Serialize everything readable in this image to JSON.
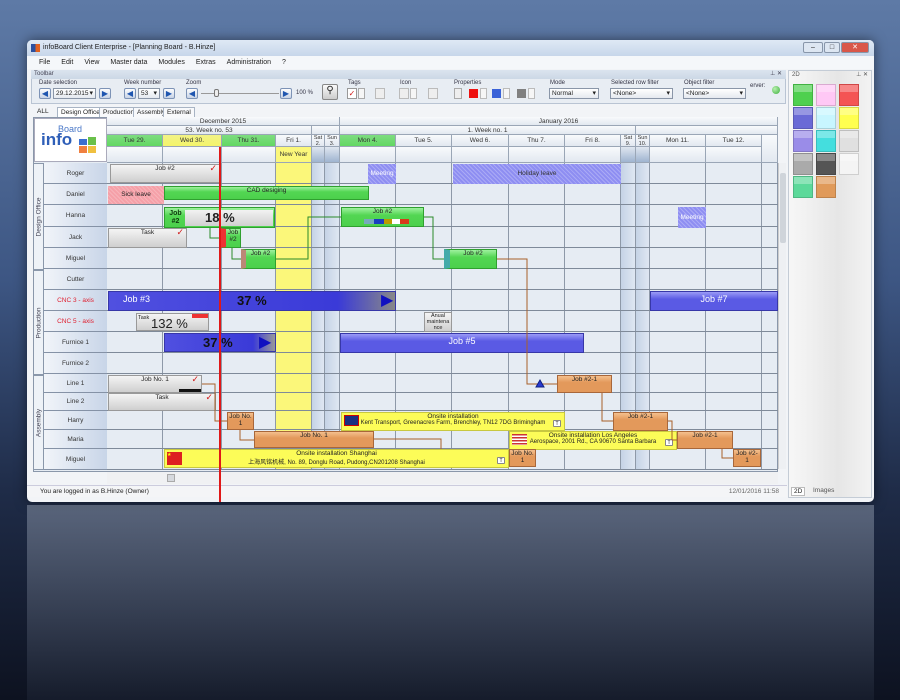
{
  "window": {
    "title": "infoBoard Client Enterprise - [Planning Board - B.Hinze]"
  },
  "menu": [
    "File",
    "Edit",
    "View",
    "Master data",
    "Modules",
    "Extras",
    "Administration",
    "?"
  ],
  "toolbar": {
    "title": "Toolbar",
    "date_label": "Date selection",
    "date_value": "29.12.2015",
    "week_label": "Week number",
    "week_value": "53",
    "zoom_label": "Zoom",
    "zoom_value": "100 %",
    "zoom_percent": 100,
    "tags_label": "Tags",
    "icon_label": "Icon",
    "properties_label": "Properties",
    "mode_label": "Mode",
    "mode_value": "Normal",
    "row_filter_label": "Selected row filter",
    "row_filter_value": "<None>",
    "object_filter_label": "Object filter",
    "object_filter_value": "<None>",
    "server_label": "erver:",
    "colors": {
      "prop1": "#ee1111",
      "prop2": "#3a62d8",
      "prop3": "#808080",
      "server": "#3cb03c"
    }
  },
  "tabs": [
    "ALL",
    "Design Office",
    "Production",
    "Assembly",
    "External"
  ],
  "calendar": {
    "months": [
      "December 2015",
      "January 2016"
    ],
    "weeks": [
      "53. Week no. 53",
      "1. Week no. 1"
    ],
    "days": [
      "Tue 29.",
      "Wed 30.",
      "Thu 31.",
      "Fri 1.",
      "Sat 2.",
      "Sun 3.",
      "Mon 4.",
      "Tue 5.",
      "Wed 6.",
      "Thu 7.",
      "Fri 8.",
      "Sat 9.",
      "Sun 10.",
      "Mon 11.",
      "Tue 12."
    ],
    "holiday": "New Year"
  },
  "groups": [
    "Design Office",
    "Production",
    "Assembly"
  ],
  "rows": [
    "Roger",
    "Daniel",
    "Hanna",
    "Jack",
    "Miguel",
    "Cutter",
    "CNC 3 - axis",
    "CNC 5 - axis",
    "Furnice 1",
    "Furnice 2",
    "Line 1",
    "Line 2",
    "Harry",
    "Maria",
    "Miguel"
  ],
  "bars": {
    "roger_job": "Job #2",
    "roger_meeting": "Meeting",
    "holiday": "Holiday leave",
    "sick": "Sick leave",
    "cad": "CAD desiging",
    "hanna_side": "Job #2",
    "hanna_pct": "18 %",
    "hanna_job": "Job #2",
    "hanna_meeting": "Meeting",
    "jack_task": "Task",
    "jack_job": "Job #2",
    "miguel_job1": "Job #2",
    "miguel_job2": "Job #2",
    "job3": "Job #3",
    "job3_pct": "37 %",
    "job7": "Job #7",
    "cnc5_task": "Task",
    "cnc5_pct": "132 %",
    "anual": "Anual maintena nce",
    "furnice_pct": "37 %",
    "job5": "Job #5",
    "line1_job": "Job No. 1",
    "line1_job21": "Job #2-1",
    "line2_task": "Task",
    "harry_job": "Job No. 1",
    "kent_title": "Onsite installation",
    "kent_addr": "Kent Transport, Greenacres Farm, Brenchley, TN12 7DG Brimingham",
    "harry_job21": "Job #2-1",
    "maria_job": "Job No. 1",
    "la_title": "Onsite installation Los Angeles",
    "la_addr": "Aerospace, 2001 Rd., CA 90670 Santa Barbara",
    "maria_job21": "Job #2-1",
    "sh_title": "Onsite installation Shanghai",
    "sh_addr": "上海风铭机械, No. 89, Donglu Road, Pudong,CN201208 Shanghai",
    "miguel_jobno": "Job No. 1",
    "miguel_job21": "Job #2- 1",
    "t": "T"
  },
  "progress": {
    "hanna": 18,
    "job3": 37,
    "cnc5": 132,
    "furnice1": 37
  },
  "panel": {
    "title": "2D",
    "tabs": [
      "2D",
      "Images"
    ],
    "swatches": [
      "#4fd04f",
      "#ffc8f5",
      "#f45454",
      "#6a6ad6",
      "#c8f6ff",
      "#ffff50",
      "#9a8ce8",
      "#44dede",
      "#e0e0e0",
      "#aaaaaa",
      "#555555",
      "#f4f4f4",
      "#5cd99a",
      "#e09a5a"
    ]
  },
  "status": {
    "user": "You are logged in as B.Hinze (Owner)",
    "datetime": "12/01/2016 11:58"
  },
  "logo": "infoBoard"
}
